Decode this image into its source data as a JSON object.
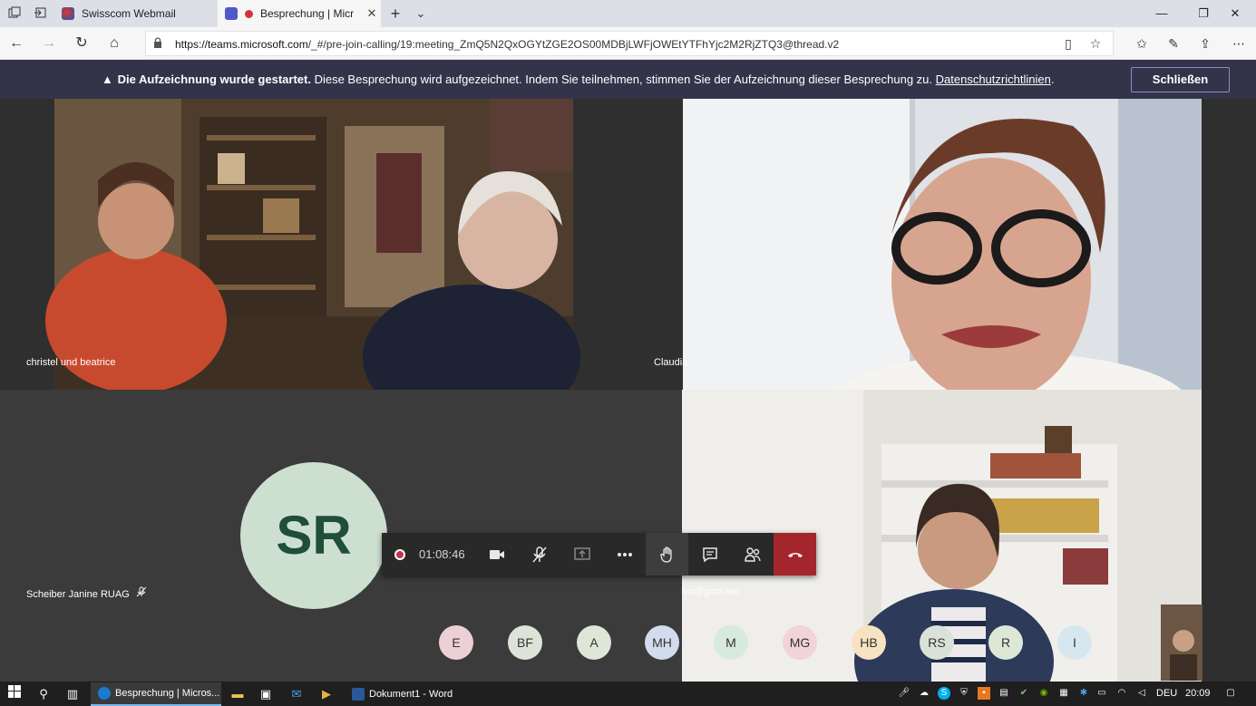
{
  "browser": {
    "tabs": [
      {
        "title": "Swisscom Webmail"
      },
      {
        "title": "Besprechung | Micr"
      }
    ],
    "url_prefix": "https://teams.microsoft.com",
    "url_rest": "/_#/pre-join-calling/19:meeting_ZmQ5N2QxOGYtZGE2OS00MDBjLWFjOWEtYTFhYjc2M2RjZTQ3@thread.v2"
  },
  "banner": {
    "bold_text": "Die Aufzeichnung wurde gestartet.",
    "text": " Diese Besprechung wird aufgezeichnet. Indem Sie teilnehmen, stimmen Sie der Aufzeichnung dieser Besprechung zu. ",
    "link": "Datenschutzrichtlinien",
    "period": ".",
    "close_label": "Schließen"
  },
  "participants": {
    "tile1": "christel und beatrice",
    "tile2": "Claudia",
    "tile3": "Scheiber Janine RUAG",
    "tile3_initials": "SR",
    "tile4": "beakolvo@gmx.net"
  },
  "callbar": {
    "timer": "01:08:46"
  },
  "roster": [
    {
      "initials": "E",
      "color": "#ecd0d6"
    },
    {
      "initials": "BF",
      "color": "#dce4d8"
    },
    {
      "initials": "A",
      "color": "#dde6d7"
    },
    {
      "initials": "MH",
      "color": "#d3dced"
    },
    {
      "initials": "M",
      "color": "#d8eadb"
    },
    {
      "initials": "MG",
      "color": "#f1d3d8"
    },
    {
      "initials": "HB",
      "color": "#f7e2c2"
    },
    {
      "initials": "RS",
      "color": "#d9e2d8"
    },
    {
      "initials": "R",
      "color": "#dce8d5"
    },
    {
      "initials": "I",
      "color": "#d7e7f0"
    }
  ],
  "taskbar": {
    "apps": [
      {
        "label": "Besprechung | Micros..."
      },
      {
        "label": "Dokument1 - Word"
      }
    ],
    "lang": "DEU",
    "time": "20:09"
  }
}
